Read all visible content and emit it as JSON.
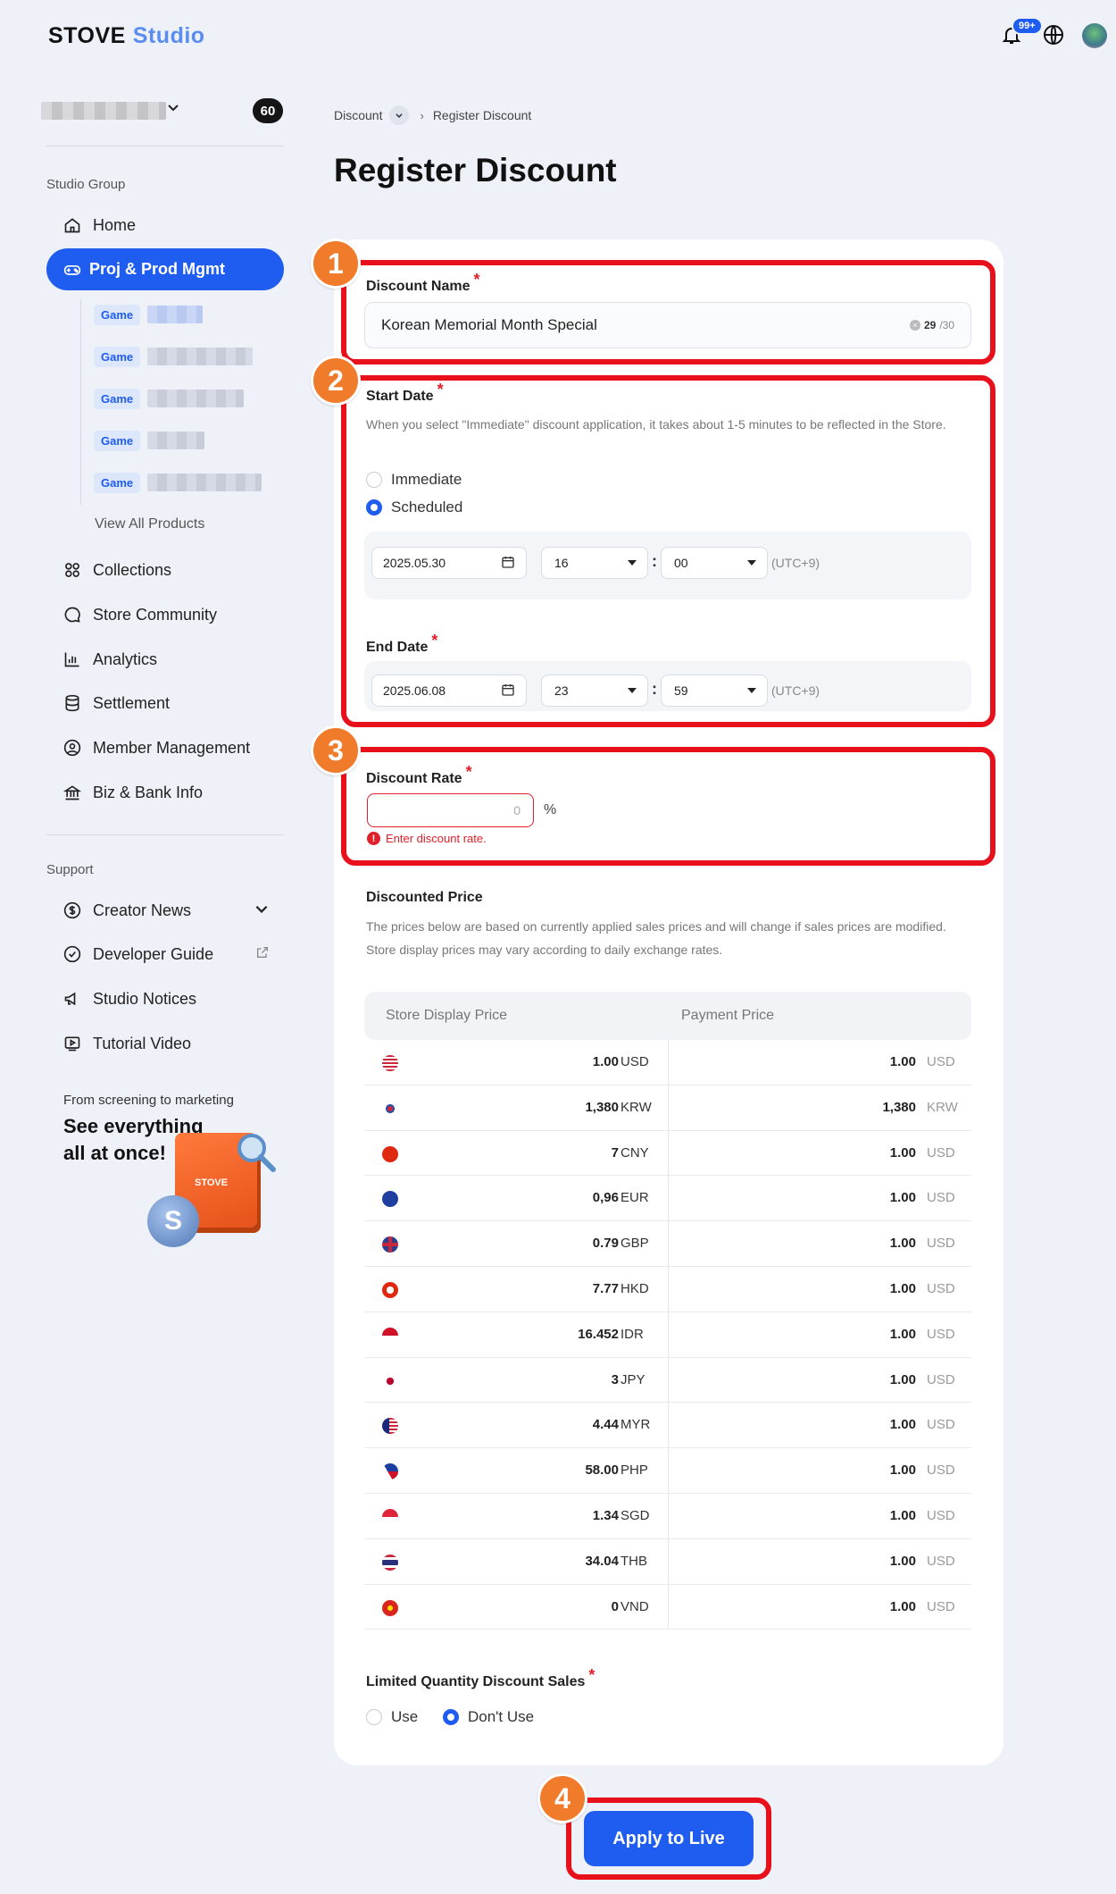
{
  "header": {
    "brand": "STOVE",
    "brand_sub": "Studio",
    "notif_badge": "99+"
  },
  "sidebar": {
    "studio_count": "60",
    "group_label": "Studio Group",
    "items": [
      {
        "label": "Home"
      },
      {
        "label": "Proj & Prod Mgmt"
      },
      {
        "label": "Collections"
      },
      {
        "label": "Store Community"
      },
      {
        "label": "Analytics"
      },
      {
        "label": "Settlement"
      },
      {
        "label": "Member Management"
      },
      {
        "label": "Biz & Bank Info"
      }
    ],
    "sub_tag": "Game",
    "view_all": "View All Products",
    "support_label": "Support",
    "support_items": [
      {
        "label": "Creator News"
      },
      {
        "label": "Developer Guide"
      },
      {
        "label": "Studio Notices"
      },
      {
        "label": "Tutorial Video"
      }
    ],
    "promo": {
      "line1": "From screening to marketing",
      "line2": "See everything",
      "line3": "all at once!",
      "box_text": "STOVE"
    }
  },
  "breadcrumb": {
    "parent": "Discount",
    "current": "Register Discount"
  },
  "page_title": "Register Discount",
  "form": {
    "discount_name": {
      "label": "Discount Name",
      "value": "Korean Memorial Month Special",
      "counter_current": "29",
      "counter_max": "/30"
    },
    "start_date": {
      "label": "Start Date",
      "help": "When you select \"Immediate\" discount application, it takes about 1-5 minutes to be reflected in the Store.",
      "opt_immediate": "Immediate",
      "opt_scheduled": "Scheduled",
      "date": "2025.05.30",
      "hour": "16",
      "minute": "00",
      "tz": "(UTC+9)"
    },
    "end_date": {
      "label": "End Date",
      "date": "2025.06.08",
      "hour": "23",
      "minute": "59",
      "tz": "(UTC+9)"
    },
    "discount_rate": {
      "label": "Discount Rate",
      "placeholder": "0",
      "unit": "%",
      "error": "Enter discount rate."
    },
    "discounted_price": {
      "label": "Discounted Price",
      "help1": "The prices below are based on currently applied sales prices and will change if sales prices are modified.",
      "help2": "Store display prices may vary according to daily exchange rates.",
      "col_store": "Store Display Price",
      "col_payment": "Payment Price",
      "rows": [
        {
          "flag": "us-flag",
          "store": "1.00",
          "store_cur": "USD",
          "pay": "1.00",
          "pay_cur": "USD"
        },
        {
          "flag": "kr-flag",
          "store": "1,380",
          "store_cur": "KRW",
          "pay": "1,380",
          "pay_cur": "KRW"
        },
        {
          "flag": "cn-flag",
          "store": "7",
          "store_cur": "CNY",
          "pay": "1.00",
          "pay_cur": "USD"
        },
        {
          "flag": "eu-flag",
          "store": "0,96",
          "store_cur": "EUR",
          "pay": "1.00",
          "pay_cur": "USD"
        },
        {
          "flag": "gb-flag",
          "store": "0.79",
          "store_cur": "GBP",
          "pay": "1.00",
          "pay_cur": "USD"
        },
        {
          "flag": "hk-flag",
          "store": "7.77",
          "store_cur": "HKD",
          "pay": "1.00",
          "pay_cur": "USD"
        },
        {
          "flag": "id-flag",
          "store": "16.452",
          "store_cur": "IDR",
          "pay": "1.00",
          "pay_cur": "USD"
        },
        {
          "flag": "jp-flag",
          "store": "3",
          "store_cur": "JPY",
          "pay": "1.00",
          "pay_cur": "USD"
        },
        {
          "flag": "my-flag",
          "store": "4.44",
          "store_cur": "MYR",
          "pay": "1.00",
          "pay_cur": "USD"
        },
        {
          "flag": "ph-flag",
          "store": "58.00",
          "store_cur": "PHP",
          "pay": "1.00",
          "pay_cur": "USD"
        },
        {
          "flag": "sg-flag",
          "store": "1.34",
          "store_cur": "SGD",
          "pay": "1.00",
          "pay_cur": "USD"
        },
        {
          "flag": "th-flag",
          "store": "34.04",
          "store_cur": "THB",
          "pay": "1.00",
          "pay_cur": "USD"
        },
        {
          "flag": "vn-flag",
          "store": "0",
          "store_cur": "VND",
          "pay": "1.00",
          "pay_cur": "USD"
        }
      ]
    },
    "limited_qty": {
      "label": "Limited Quantity Discount Sales",
      "opt_use": "Use",
      "opt_dont": "Don't Use"
    }
  },
  "apply_button": "Apply to Live",
  "callouts": [
    "1",
    "2",
    "3",
    "4"
  ],
  "colors": {
    "primary": "#1f5cf0",
    "highlight": "#e8101a",
    "callout": "#ef7b2b",
    "error": "#e0202a"
  }
}
